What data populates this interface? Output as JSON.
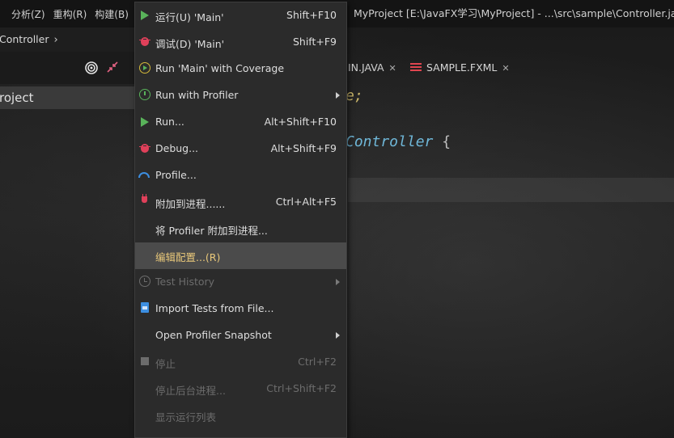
{
  "menubar": {
    "items": [
      "分析(Z)",
      "重构(R)",
      "构建(B)"
    ],
    "window_title": "MyProject [E:\\JavaFX学习\\MyProject] - ...\\src\\sample\\Controller.java"
  },
  "breadcrumb": {
    "text": "Controller"
  },
  "project_panel": {
    "root": "roject"
  },
  "editor": {
    "tabs": [
      {
        "label": "IN.JAVA"
      },
      {
        "label": "SAMPLE.FXML"
      }
    ],
    "code_lines": [
      "e;",
      "Controller",
      "{"
    ]
  },
  "run_menu": {
    "items": [
      {
        "label": "运行(U) 'Main'",
        "shortcut": "Shift+F10",
        "icon": "run-icon",
        "state": "normal"
      },
      {
        "label": "调试(D) 'Main'",
        "shortcut": "Shift+F9",
        "icon": "debug-icon",
        "state": "normal"
      },
      {
        "label": "Run 'Main' with Coverage",
        "shortcut": "",
        "icon": "coverage-icon",
        "state": "normal"
      },
      {
        "label": "Run with Profiler",
        "shortcut": "",
        "icon": "profiler-icon",
        "state": "normal",
        "submenu": true
      },
      {
        "label": "Run...",
        "shortcut": "Alt+Shift+F10",
        "icon": "run-icon",
        "state": "normal"
      },
      {
        "label": "Debug...",
        "shortcut": "Alt+Shift+F9",
        "icon": "debug-icon",
        "state": "normal"
      },
      {
        "label": "Profile...",
        "shortcut": "",
        "icon": "profile-gauge-icon",
        "state": "normal"
      },
      {
        "label": "附加到进程......",
        "shortcut": "Ctrl+Alt+F5",
        "icon": "attach-plug-icon",
        "state": "normal"
      },
      {
        "label": "将 Profiler 附加到进程...",
        "shortcut": "",
        "icon": "",
        "state": "normal"
      },
      {
        "label": "编辑配置...(R)",
        "shortcut": "",
        "icon": "",
        "state": "selected"
      },
      {
        "label": "Test History",
        "shortcut": "",
        "icon": "history-icon",
        "state": "disabled",
        "submenu": true
      },
      {
        "label": "Import Tests from File...",
        "shortcut": "",
        "icon": "import-file-icon",
        "state": "normal"
      },
      {
        "label": "Open Profiler Snapshot",
        "shortcut": "",
        "icon": "",
        "state": "normal",
        "submenu": true
      },
      {
        "label": "停止",
        "shortcut": "Ctrl+F2",
        "icon": "stop-icon",
        "state": "disabled"
      },
      {
        "label": "停止后台进程...",
        "shortcut": "Ctrl+Shift+F2",
        "icon": "",
        "state": "disabled"
      },
      {
        "label": "显示运行列表",
        "shortcut": "",
        "icon": "",
        "state": "disabled"
      }
    ]
  },
  "colors": {
    "menu_bg": "#2b2b2b",
    "selected_bg": "#4b4b4b",
    "selected_text": "#e9c87a",
    "disabled_text": "#6c6c6c",
    "run_green": "#59b35a",
    "debug_red": "#e0405a"
  }
}
